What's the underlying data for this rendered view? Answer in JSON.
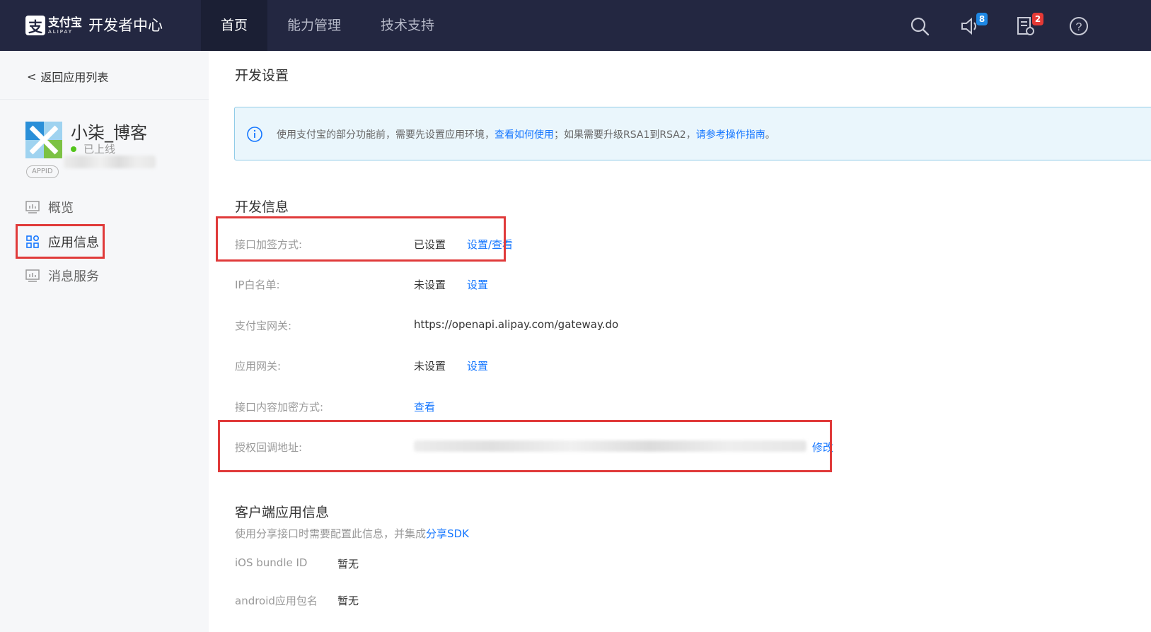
{
  "header": {
    "logo_cn": "支付宝",
    "logo_en": "ALIPAY",
    "portal_title": "开发者中心",
    "nav": [
      {
        "label": "首页",
        "active": true
      },
      {
        "label": "能力管理",
        "active": false
      },
      {
        "label": "技术支持",
        "active": false
      }
    ],
    "icons": {
      "search": "search-icon",
      "notice": "speaker-icon",
      "notice_badge": "8",
      "tasks": "task-list-icon",
      "tasks_badge": "2",
      "help": "help-icon"
    }
  },
  "sidebar": {
    "back_label": "返回应用列表",
    "app_name": "小柒_博客",
    "app_status": "已上线",
    "appid_tag": "APPID",
    "menu": [
      {
        "label": "概览",
        "icon": "chart-icon",
        "active": false
      },
      {
        "label": "应用信息",
        "icon": "grid-icon",
        "active": true
      },
      {
        "label": "消息服务",
        "icon": "chart-icon",
        "active": false
      }
    ]
  },
  "main": {
    "dev_settings_title": "开发设置",
    "notice": {
      "text_1": "使用支付宝的部分功能前，需要先设置应用环境，",
      "link_1": "查看如何使用",
      "text_2": "；如果需要升级RSA1到RSA2，",
      "link_2": "请参考操作指南",
      "text_3": "。"
    },
    "dev_info_title": "开发信息",
    "rows": [
      {
        "label": "接口加签方式:",
        "value": "已设置",
        "link": "设置/查看"
      },
      {
        "label": "IP白名单:",
        "value": "未设置",
        "link": "设置"
      },
      {
        "label": "支付宝网关:",
        "value": "https://openapi.alipay.com/gateway.do",
        "link": ""
      },
      {
        "label": "应用网关:",
        "value": "未设置",
        "link": "设置"
      },
      {
        "label": "接口内容加密方式:",
        "value": "",
        "link": "查看"
      },
      {
        "label": "授权回调地址:",
        "value": "",
        "link": "修改"
      }
    ],
    "client_title": "客户端应用信息",
    "client_desc": "使用分享接口时需要配置此信息，并集成",
    "client_desc_link": "分享SDK",
    "client_rows": [
      {
        "label": "iOS bundle ID",
        "value": "暂无"
      },
      {
        "label": "android应用包名",
        "value": "暂无"
      }
    ]
  },
  "colors": {
    "topbar": "#232741",
    "link": "#1677ff",
    "highlight": "#e03a3a",
    "badge_blue": "#1e88e5",
    "badge_red": "#e53935"
  }
}
